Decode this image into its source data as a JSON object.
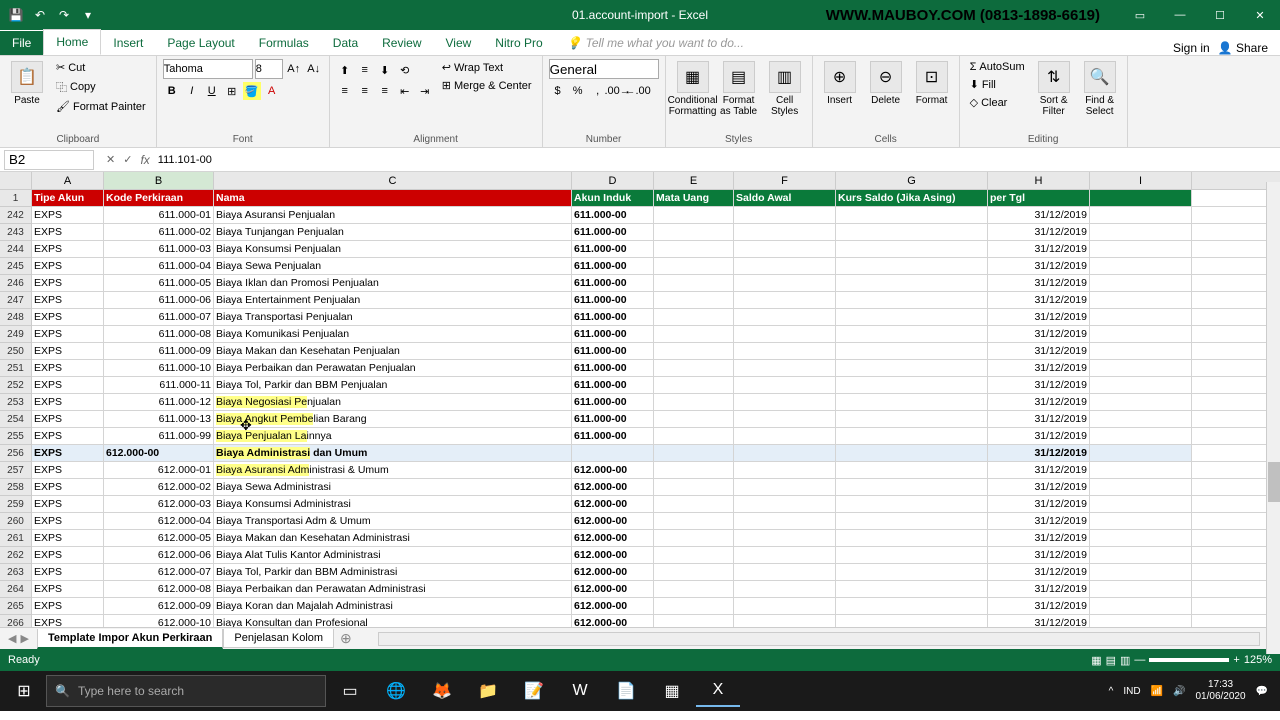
{
  "app": {
    "title": "01.account-import - Excel",
    "watermark": "WWW.MAUBOY.COM (0813-1898-6619)"
  },
  "tabs": {
    "file": "File",
    "home": "Home",
    "insert": "Insert",
    "pagelayout": "Page Layout",
    "formulas": "Formulas",
    "data": "Data",
    "review": "Review",
    "view": "View",
    "nitro": "Nitro Pro",
    "tellme": "Tell me what you want to do...",
    "signin": "Sign in",
    "share": "Share"
  },
  "ribbon": {
    "clipboard": {
      "paste": "Paste",
      "cut": "Cut",
      "copy": "Copy",
      "painter": "Format Painter",
      "label": "Clipboard"
    },
    "font": {
      "name": "Tahoma",
      "size": "8",
      "label": "Font"
    },
    "align": {
      "wrap": "Wrap Text",
      "merge": "Merge & Center",
      "label": "Alignment"
    },
    "number": {
      "format": "General",
      "label": "Number"
    },
    "styles": {
      "cond": "Conditional Formatting",
      "table": "Format as Table",
      "cell": "Cell Styles",
      "label": "Styles"
    },
    "cells": {
      "insert": "Insert",
      "delete": "Delete",
      "format": "Format",
      "label": "Cells"
    },
    "editing": {
      "sum": "AutoSum",
      "fill": "Fill",
      "clear": "Clear",
      "sort": "Sort & Filter",
      "find": "Find & Select",
      "label": "Editing"
    }
  },
  "cellref": {
    "name": "B2",
    "formula": "111.101-00"
  },
  "columns": [
    "A",
    "B",
    "C",
    "D",
    "E",
    "F",
    "G",
    "H",
    "I"
  ],
  "headers": {
    "A": "Tipe Akun",
    "B": "Kode Perkiraan",
    "C": "Nama",
    "D": "Akun Induk",
    "E": "Mata Uang",
    "F": "Saldo Awal",
    "G": "Kurs Saldo (Jika Asing)",
    "H": "per Tgl"
  },
  "rows": [
    {
      "n": 242,
      "a": "EXPS",
      "b": "611.000-01",
      "c": "Biaya Asuransi Penjualan",
      "d": "611.000-00",
      "h": "31/12/2019"
    },
    {
      "n": 243,
      "a": "EXPS",
      "b": "611.000-02",
      "c": "Biaya Tunjangan Penjualan",
      "d": "611.000-00",
      "h": "31/12/2019"
    },
    {
      "n": 244,
      "a": "EXPS",
      "b": "611.000-03",
      "c": "Biaya Konsumsi Penjualan",
      "d": "611.000-00",
      "h": "31/12/2019"
    },
    {
      "n": 245,
      "a": "EXPS",
      "b": "611.000-04",
      "c": "Biaya Sewa Penjualan",
      "d": "611.000-00",
      "h": "31/12/2019"
    },
    {
      "n": 246,
      "a": "EXPS",
      "b": "611.000-05",
      "c": "Biaya Iklan dan Promosi Penjualan",
      "d": "611.000-00",
      "h": "31/12/2019"
    },
    {
      "n": 247,
      "a": "EXPS",
      "b": "611.000-06",
      "c": "Biaya Entertainment Penjualan",
      "d": "611.000-00",
      "h": "31/12/2019"
    },
    {
      "n": 248,
      "a": "EXPS",
      "b": "611.000-07",
      "c": "Biaya Transportasi Penjualan",
      "d": "611.000-00",
      "h": "31/12/2019"
    },
    {
      "n": 249,
      "a": "EXPS",
      "b": "611.000-08",
      "c": "Biaya Komunikasi Penjualan",
      "d": "611.000-00",
      "h": "31/12/2019"
    },
    {
      "n": 250,
      "a": "EXPS",
      "b": "611.000-09",
      "c": "Biaya Makan dan Kesehatan Penjualan",
      "d": "611.000-00",
      "h": "31/12/2019"
    },
    {
      "n": 251,
      "a": "EXPS",
      "b": "611.000-10",
      "c": "Biaya Perbaikan dan Perawatan Penjualan",
      "d": "611.000-00",
      "h": "31/12/2019"
    },
    {
      "n": 252,
      "a": "EXPS",
      "b": "611.000-11",
      "c": "Biaya Tol, Parkir dan BBM Penjualan",
      "d": "611.000-00",
      "h": "31/12/2019"
    },
    {
      "n": 253,
      "a": "EXPS",
      "b": "611.000-12",
      "c": "Biaya Negosiasi Penjualan",
      "d": "611.000-00",
      "h": "31/12/2019",
      "hl": [
        247,
        283
      ]
    },
    {
      "n": 254,
      "a": "EXPS",
      "b": "611.000-13",
      "c": "Biaya Angkut Pembelian Barang",
      "d": "611.000-00",
      "h": "31/12/2019",
      "hl": true
    },
    {
      "n": 255,
      "a": "EXPS",
      "b": "611.000-99",
      "c": "Biaya Penjualan Lainnya",
      "d": "611.000-00",
      "h": "31/12/2019",
      "hl": true
    },
    {
      "n": 256,
      "a": "EXPS",
      "b": "612.000-00",
      "c": "Biaya Administrasi dan Umum",
      "d": "",
      "h": "31/12/2019",
      "bold": true,
      "hl": true
    },
    {
      "n": 257,
      "a": "EXPS",
      "b": "612.000-01",
      "c": "Biaya Asuransi Administrasi & Umum",
      "d": "612.000-00",
      "h": "31/12/2019",
      "hl": true
    },
    {
      "n": 258,
      "a": "EXPS",
      "b": "612.000-02",
      "c": "Biaya Sewa Administrasi",
      "d": "612.000-00",
      "h": "31/12/2019"
    },
    {
      "n": 259,
      "a": "EXPS",
      "b": "612.000-03",
      "c": "Biaya Konsumsi Administrasi",
      "d": "612.000-00",
      "h": "31/12/2019"
    },
    {
      "n": 260,
      "a": "EXPS",
      "b": "612.000-04",
      "c": "Biaya Transportasi Adm & Umum",
      "d": "612.000-00",
      "h": "31/12/2019"
    },
    {
      "n": 261,
      "a": "EXPS",
      "b": "612.000-05",
      "c": "Biaya Makan dan Kesehatan Administrasi",
      "d": "612.000-00",
      "h": "31/12/2019"
    },
    {
      "n": 262,
      "a": "EXPS",
      "b": "612.000-06",
      "c": "Biaya Alat Tulis Kantor Administrasi",
      "d": "612.000-00",
      "h": "31/12/2019"
    },
    {
      "n": 263,
      "a": "EXPS",
      "b": "612.000-07",
      "c": "Biaya Tol, Parkir dan BBM Administrasi",
      "d": "612.000-00",
      "h": "31/12/2019"
    },
    {
      "n": 264,
      "a": "EXPS",
      "b": "612.000-08",
      "c": "Biaya Perbaikan dan Perawatan Administrasi",
      "d": "612.000-00",
      "h": "31/12/2019"
    },
    {
      "n": 265,
      "a": "EXPS",
      "b": "612.000-09",
      "c": "Biaya Koran dan Majalah Administrasi",
      "d": "612.000-00",
      "h": "31/12/2019"
    },
    {
      "n": 266,
      "a": "EXPS",
      "b": "612.000-10",
      "c": "Biaya Konsultan dan Profesional",
      "d": "612.000-00",
      "h": "31/12/2019"
    }
  ],
  "sheets": {
    "tab1": "Template Impor Akun Perkiraan",
    "tab2": "Penjelasan Kolom"
  },
  "status": {
    "ready": "Ready",
    "zoom": "125%"
  },
  "taskbar": {
    "search": "Type here to search",
    "time": "17:33",
    "date": "01/06/2020"
  }
}
